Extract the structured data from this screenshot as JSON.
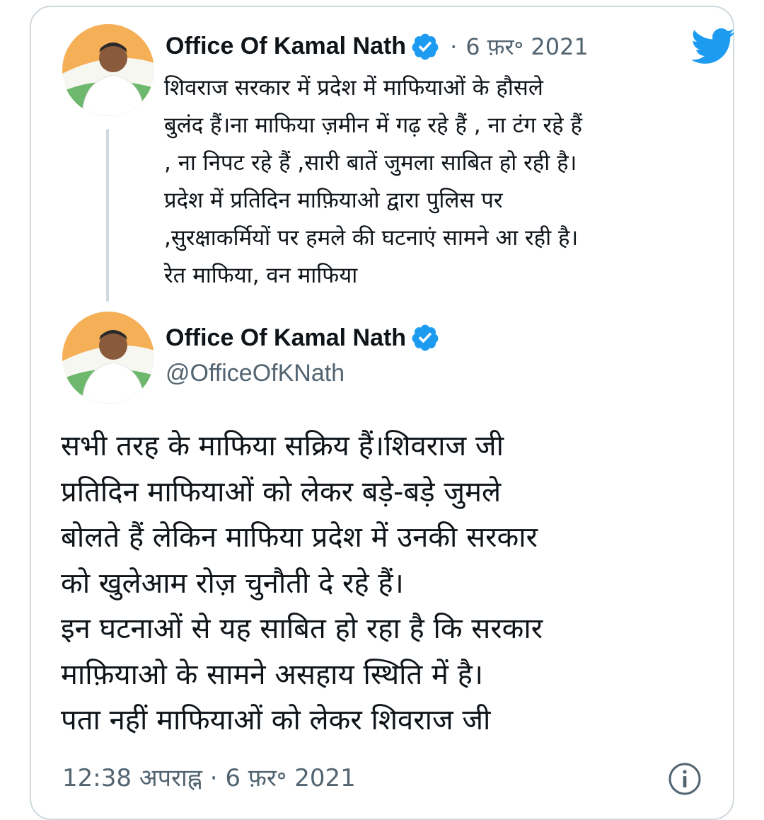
{
  "colors": {
    "accent": "#1d9bf0",
    "muted": "#536471",
    "text": "#0f1419",
    "border": "#cfd9de"
  },
  "quoted_tweet": {
    "author_name": "Office Of Kamal Nath",
    "separator": "·",
    "date": "6 फ़र॰ 2021",
    "lines": [
      "शिवराज सरकार में प्रदेश में माफियाओं के हौसले",
      "बुलंद हैं।ना माफिया ज़मीन में गढ़ रहे हैं , ना टंग रहे हैं",
      ", ना निपट रहे हैं ,सारी बातें जुमला साबित हो रही है।",
      "प्रदेश में प्रतिदिन माफ़ियाओ द्वारा पुलिस पर",
      ",सुरक्षाकर्मियों पर हमले की घटनाएं सामने आ रही है।",
      "रेत माफिया, वन माफिया"
    ]
  },
  "main_tweet": {
    "author_name": "Office Of Kamal Nath",
    "handle": "@OfficeOfKNath",
    "lines": [
      "सभी तरह के माफिया सक्रिय हैं।शिवराज जी",
      "प्रतिदिन माफियाओं को लेकर बड़े-बड़े जुमले",
      "बोलते हैं लेकिन माफिया प्रदेश में उनकी सरकार",
      "को खुलेआम रोज़ चुनौती दे रहे हैं।",
      "इन घटनाओं से यह साबित हो रहा है कि सरकार",
      "माफ़ियाओ के सामने असहाय स्थिति में है।",
      "पता नहीं माफियाओं को लेकर शिवराज जी"
    ],
    "timestamp": "12:38 अपराह्न · 6 फ़र॰ 2021"
  },
  "icons": {
    "verified": "verified-badge-icon",
    "twitter": "twitter-bird-icon",
    "info": "info-icon"
  }
}
